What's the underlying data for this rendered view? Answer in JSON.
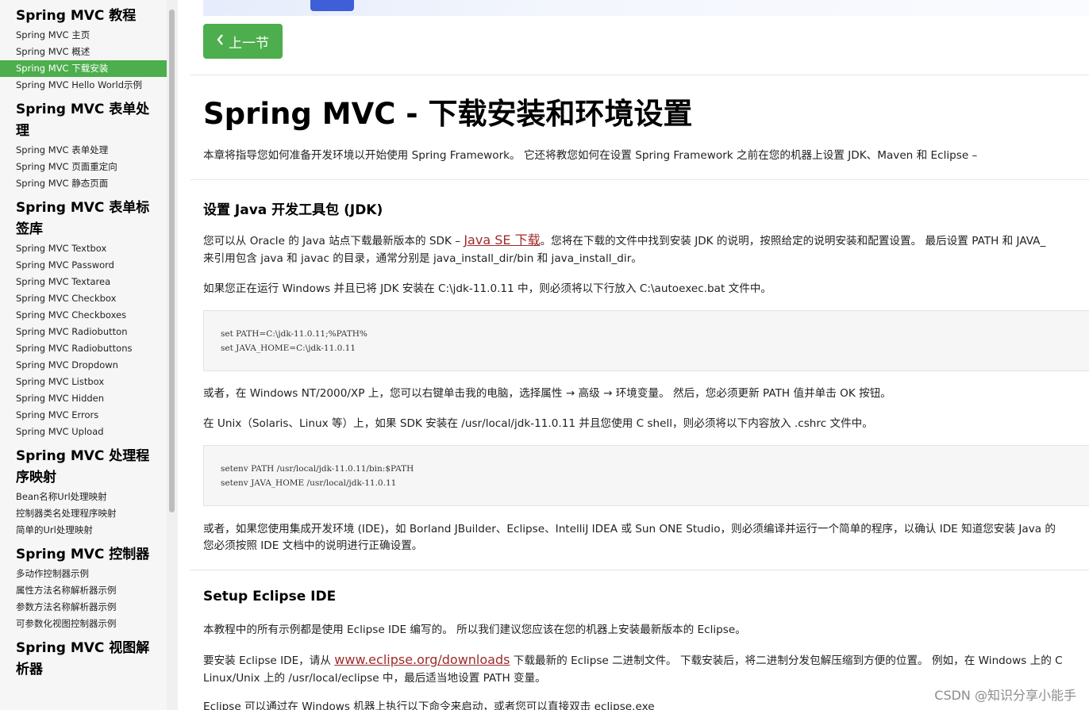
{
  "sidebar": {
    "groups": [
      {
        "title": "Spring MVC 教程",
        "items": [
          "Spring MVC 主页",
          "Spring MVC 概述",
          "Spring MVC 下载安装",
          "Spring MVC Hello World示例"
        ]
      },
      {
        "title": "Spring MVC 表单处理",
        "items": [
          "Spring MVC 表单处理",
          "Spring MVC 页面重定向",
          "Spring MVC 静态页面"
        ]
      },
      {
        "title": "Spring MVC 表单标签库",
        "items": [
          "Spring MVC Textbox",
          "Spring MVC Password",
          "Spring MVC Textarea",
          "Spring MVC Checkbox",
          "Spring MVC Checkboxes",
          "Spring MVC Radiobutton",
          "Spring MVC Radiobuttons",
          "Spring MVC Dropdown",
          "Spring MVC Listbox",
          "Spring MVC Hidden",
          "Spring MVC Errors",
          "Spring MVC Upload"
        ]
      },
      {
        "title": "Spring MVC 处理程序映射",
        "items": [
          "Bean名称Url处理映射",
          "控制器类名处理程序映射",
          "简单的Url处理映射"
        ]
      },
      {
        "title": "Spring MVC 控制器",
        "items": [
          "多动作控制器示例",
          "属性方法名称解析器示例",
          "参数方法名称解析器示例",
          "可参数化视图控制器示例"
        ]
      },
      {
        "title": "Spring MVC 视图解析器",
        "items": []
      }
    ],
    "active_item": "Spring MVC 下载安装"
  },
  "main": {
    "prev_button": "上一节",
    "title": "Spring MVC - 下载安装和环境设置",
    "intro": "本章将指导您如何准备开发环境以开始使用 Spring Framework。 它还将教您如何在设置 Spring Framework 之前在您的机器上设置 JDK、Maven 和 Eclipse –",
    "jdk": {
      "heading": "设置 Java 开发工具包 (JDK)",
      "p1_before": "您可以从 Oracle 的 Java 站点下载最新版本的 SDK – ",
      "p1_link": "Java SE 下载",
      "p1_after": "。您将在下载的文件中找到安装 JDK 的说明，按照给定的说明安装和配置设置。 最后设置 PATH 和 JAVA_",
      "p1_line2": "来引用包含 java 和 javac 的目录，通常分别是 java_install_dir/bin 和 java_install_dir。",
      "p2": "如果您正在运行 Windows 并且已将 JDK 安装在 C:\\jdk-11.0.11 中，则必须将以下行放入 C:\\autoexec.bat 文件中。",
      "code1": [
        "set PATH=C:\\jdk-11.0.11;%PATH%",
        "set JAVA_HOME=C:\\jdk-11.0.11"
      ],
      "p3": "或者，在 Windows NT/2000/XP 上，您可以右键单击我的电脑，选择属性 → 高级 → 环境变量。 然后，您必须更新 PATH 值并单击 OK 按钮。",
      "p4": "在 Unix（Solaris、Linux 等）上，如果 SDK 安装在 /usr/local/jdk-11.0.11 并且您使用 C shell，则必须将以下内容放入 .cshrc 文件中。",
      "code2": [
        "setenv PATH /usr/local/jdk-11.0.11/bin:$PATH",
        "setenv JAVA_HOME /usr/local/jdk-11.0.11"
      ],
      "p5_line1": "或者，如果您使用集成开发环境 (IDE)，如 Borland JBuilder、Eclipse、IntelliJ IDEA 或 Sun ONE Studio，则必须编译并运行一个简单的程序，以确认 IDE 知道您安装 Java 的",
      "p5_line2": "您必须按照 IDE 文档中的说明进行正确设置。"
    },
    "eclipse": {
      "heading": "Setup Eclipse IDE",
      "p1": "本教程中的所有示例都是使用 Eclipse IDE 编写的。 所以我们建议您应该在您的机器上安装最新版本的 Eclipse。",
      "p2_before": "要安装 Eclipse IDE，请从 ",
      "p2_link": "www.eclipse.org/downloads",
      "p2_after": " 下载最新的 Eclipse 二进制文件。 下载安装后，将二进制分发包解压缩到方便的位置。 例如，在 Windows 上的 C",
      "p2_line2": "Linux/Unix 上的 /usr/local/eclipse 中，最后适当地设置 PATH 变量。",
      "p3": "Eclipse 可以通过在 Windows 机器上执行以下命令来启动，或者您可以直接双击 eclipse.exe"
    }
  },
  "watermark": "CSDN @知识分享小能手"
}
